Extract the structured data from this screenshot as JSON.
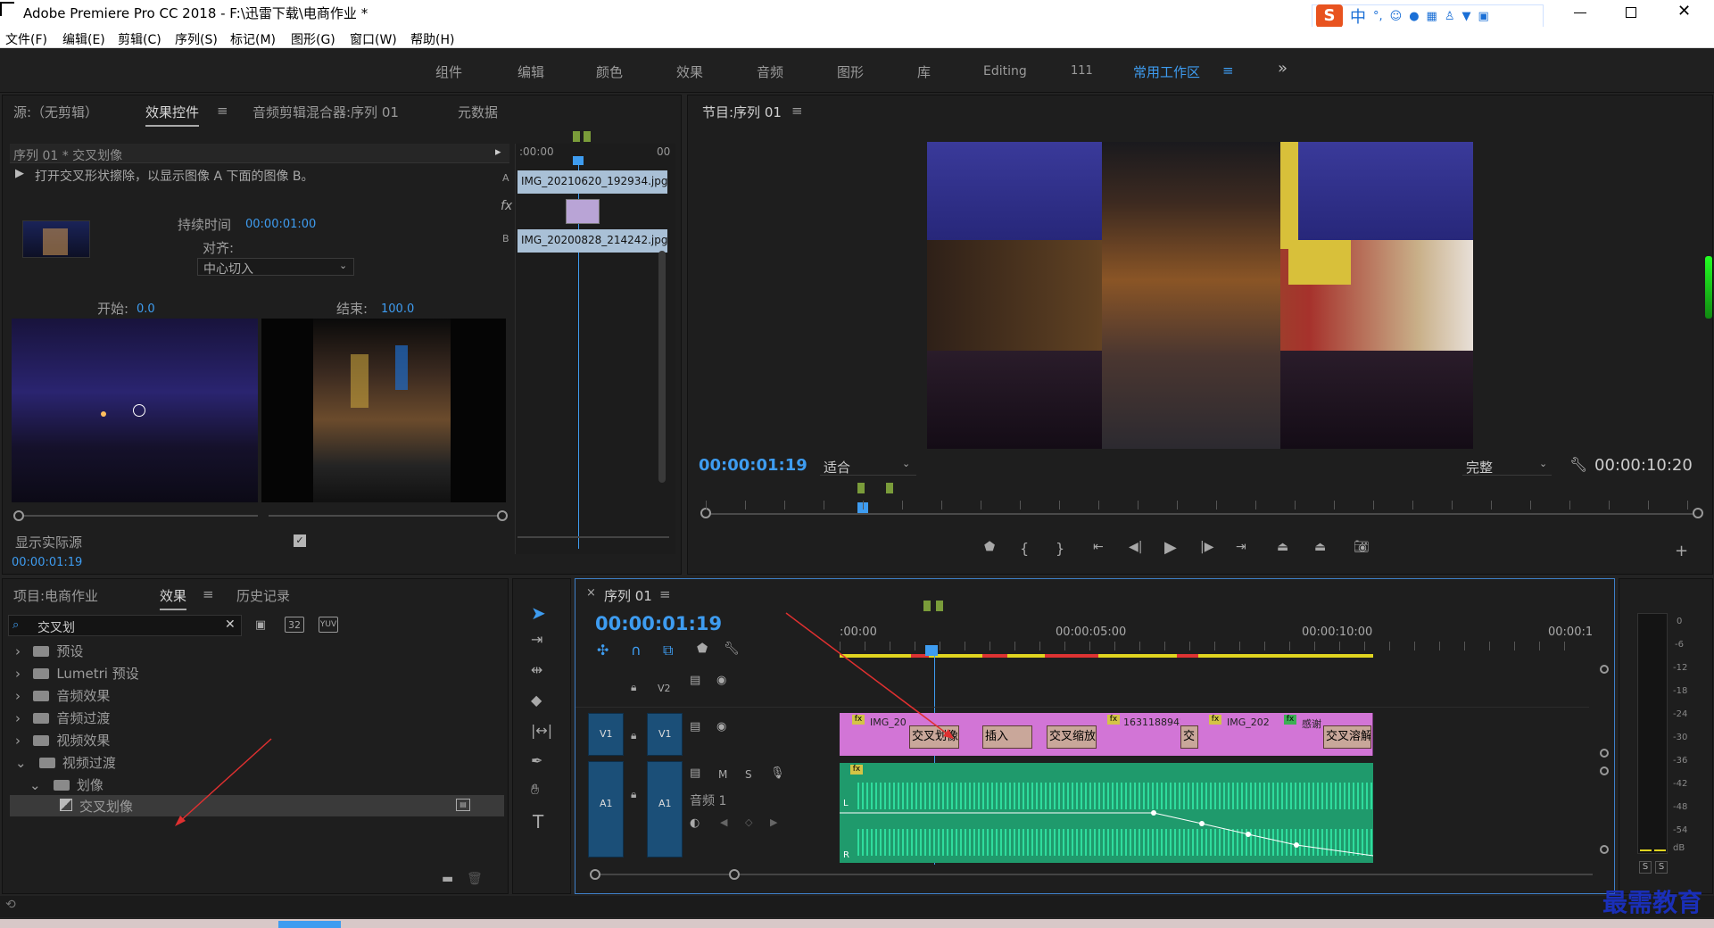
{
  "app": {
    "title": "Adobe Premiere Pro CC 2018 - F:\\迅雷下载\\电商作业 *",
    "ime": "中"
  },
  "menu": [
    "文件(F)",
    "编辑(E)",
    "剪辑(C)",
    "序列(S)",
    "标记(M)",
    "图形(G)",
    "窗口(W)",
    "帮助(H)"
  ],
  "workspaces": [
    "组件",
    "编辑",
    "颜色",
    "效果",
    "音频",
    "图形",
    "库",
    "Editing",
    "111",
    "常用工作区"
  ],
  "source": {
    "tabs": [
      "源:（无剪辑）",
      "效果控件",
      "音频剪辑混合器:序列 01",
      "元数据"
    ],
    "clip_path": "序列 01 * 交叉划像",
    "desc": "打开交叉形状擦除，以显示图像 A 下面的图像 B。",
    "duration_label": "持续时间",
    "duration": "00:00:01:00",
    "align_label": "对齐:",
    "align_value": "中心切入",
    "start_label": "开始:",
    "start_value": "0.0",
    "end_label": "结束:",
    "end_value": "100.0",
    "show_actual": "显示实际源",
    "timecode": "00:00:01:19",
    "mini_time": ":00:00",
    "mini_time2": "00",
    "clip_a": "IMG_20210620_192934.jpg",
    "clip_b": "IMG_20200828_214242.jpg",
    "label_a": "A",
    "label_b": "B",
    "fx": "fx"
  },
  "program": {
    "title": "节目:序列 01",
    "timecode": "00:00:01:19",
    "fit": "适合",
    "quality": "完整",
    "duration": "00:00:10:20"
  },
  "project": {
    "tabs": [
      "项目:电商作业",
      "效果",
      "历史记录"
    ],
    "search": "交叉划",
    "items": [
      {
        "label": "预设",
        "indent": 0
      },
      {
        "label": "Lumetri 预设",
        "indent": 0
      },
      {
        "label": "音频效果",
        "indent": 0
      },
      {
        "label": "音频过渡",
        "indent": 0
      },
      {
        "label": "视频效果",
        "indent": 0
      },
      {
        "label": "视频过渡",
        "indent": 0,
        "open": true
      },
      {
        "label": "划像",
        "indent": 1,
        "open": true
      },
      {
        "label": "交叉划像",
        "indent": 2,
        "selected": true
      }
    ]
  },
  "timeline": {
    "title": "序列 01",
    "timecode": "00:00:01:19",
    "ruler": [
      ":00:00",
      "00:00:05:00",
      "00:00:10:00",
      "00:00:1"
    ],
    "tracks": {
      "v2": "V2",
      "v1": "V1",
      "a1": "A1",
      "audio_name": "音频 1",
      "m": "M",
      "s": "S"
    },
    "clips": [
      {
        "label": "IMG_20"
      },
      {
        "label": "交叉划像"
      },
      {
        "label": "插入"
      },
      {
        "label": "交叉缩放"
      },
      {
        "label": "1631188942"
      },
      {
        "label": "交"
      },
      {
        "label": "IMG_202"
      },
      {
        "label": "感谢"
      },
      {
        "label": "交叉溶解"
      }
    ]
  },
  "meter": {
    "scale": [
      "0",
      "-6",
      "-12",
      "-18",
      "-24",
      "-30",
      "-36",
      "-42",
      "-48",
      "-54",
      "dB"
    ],
    "s1": "S",
    "s2": "S"
  },
  "watermark": "最需教育"
}
